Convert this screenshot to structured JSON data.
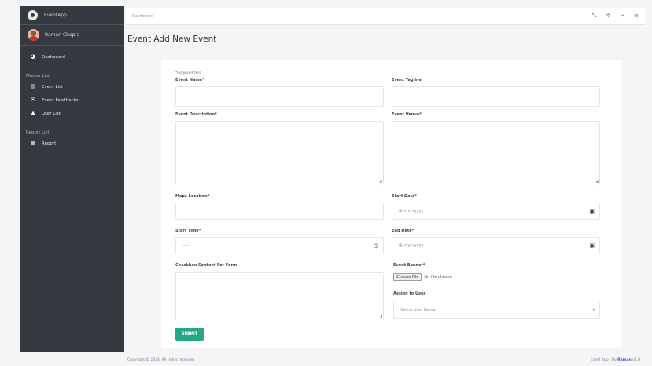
{
  "sidebar": {
    "brand": "EventApp",
    "user": "Raman Chopra",
    "dashboard": "Dashboard",
    "master_header": "Master List",
    "items": [
      "Event List",
      "Event Feedbacks",
      "User List"
    ],
    "report_header": "Report List",
    "report_item": "Report"
  },
  "topbar": {
    "breadcrumb": "Dashboard",
    "icons": [
      "compress-icon",
      "gear-icon",
      "logout-icon",
      "menu-icon"
    ]
  },
  "page": {
    "title": "Event Add New Event"
  },
  "form": {
    "required_note": "*Required field",
    "event_name": {
      "label": "Event Name*",
      "value": ""
    },
    "event_tagline": {
      "label": "Event Tagline",
      "value": ""
    },
    "event_description": {
      "label": "Event Description*",
      "value": ""
    },
    "event_venue": {
      "label": "Event Venue*",
      "value": ""
    },
    "maps_location": {
      "label": "Maps Location*",
      "value": ""
    },
    "start_date": {
      "label": "Start Date*",
      "placeholder": "dd-mm-yyyy"
    },
    "start_time": {
      "label": "Start Time*",
      "placeholder": "--:--"
    },
    "end_date": {
      "label": "End Date*",
      "placeholder": "dd-mm-yyyy"
    },
    "checkbox_content": {
      "label": "Checkbox Content For Form",
      "value": ""
    },
    "event_banner": {
      "label": "Event Banner*",
      "button": "Choose File",
      "status": "No file chosen"
    },
    "assign_user": {
      "label": "Assign to User",
      "selected": "Select User Name"
    },
    "submit": "SUBMIT"
  },
  "footer": {
    "copyright": "Copyright © 2024. All rights reserved.",
    "credit_prefix": "Event App | By",
    "credit_brand": "Raman",
    "credit_suffix": "v1.0"
  },
  "colors": {
    "sidebar_bg": "#343a40",
    "submit_bg": "#28a785",
    "page_bg": "#f4f5f7"
  }
}
